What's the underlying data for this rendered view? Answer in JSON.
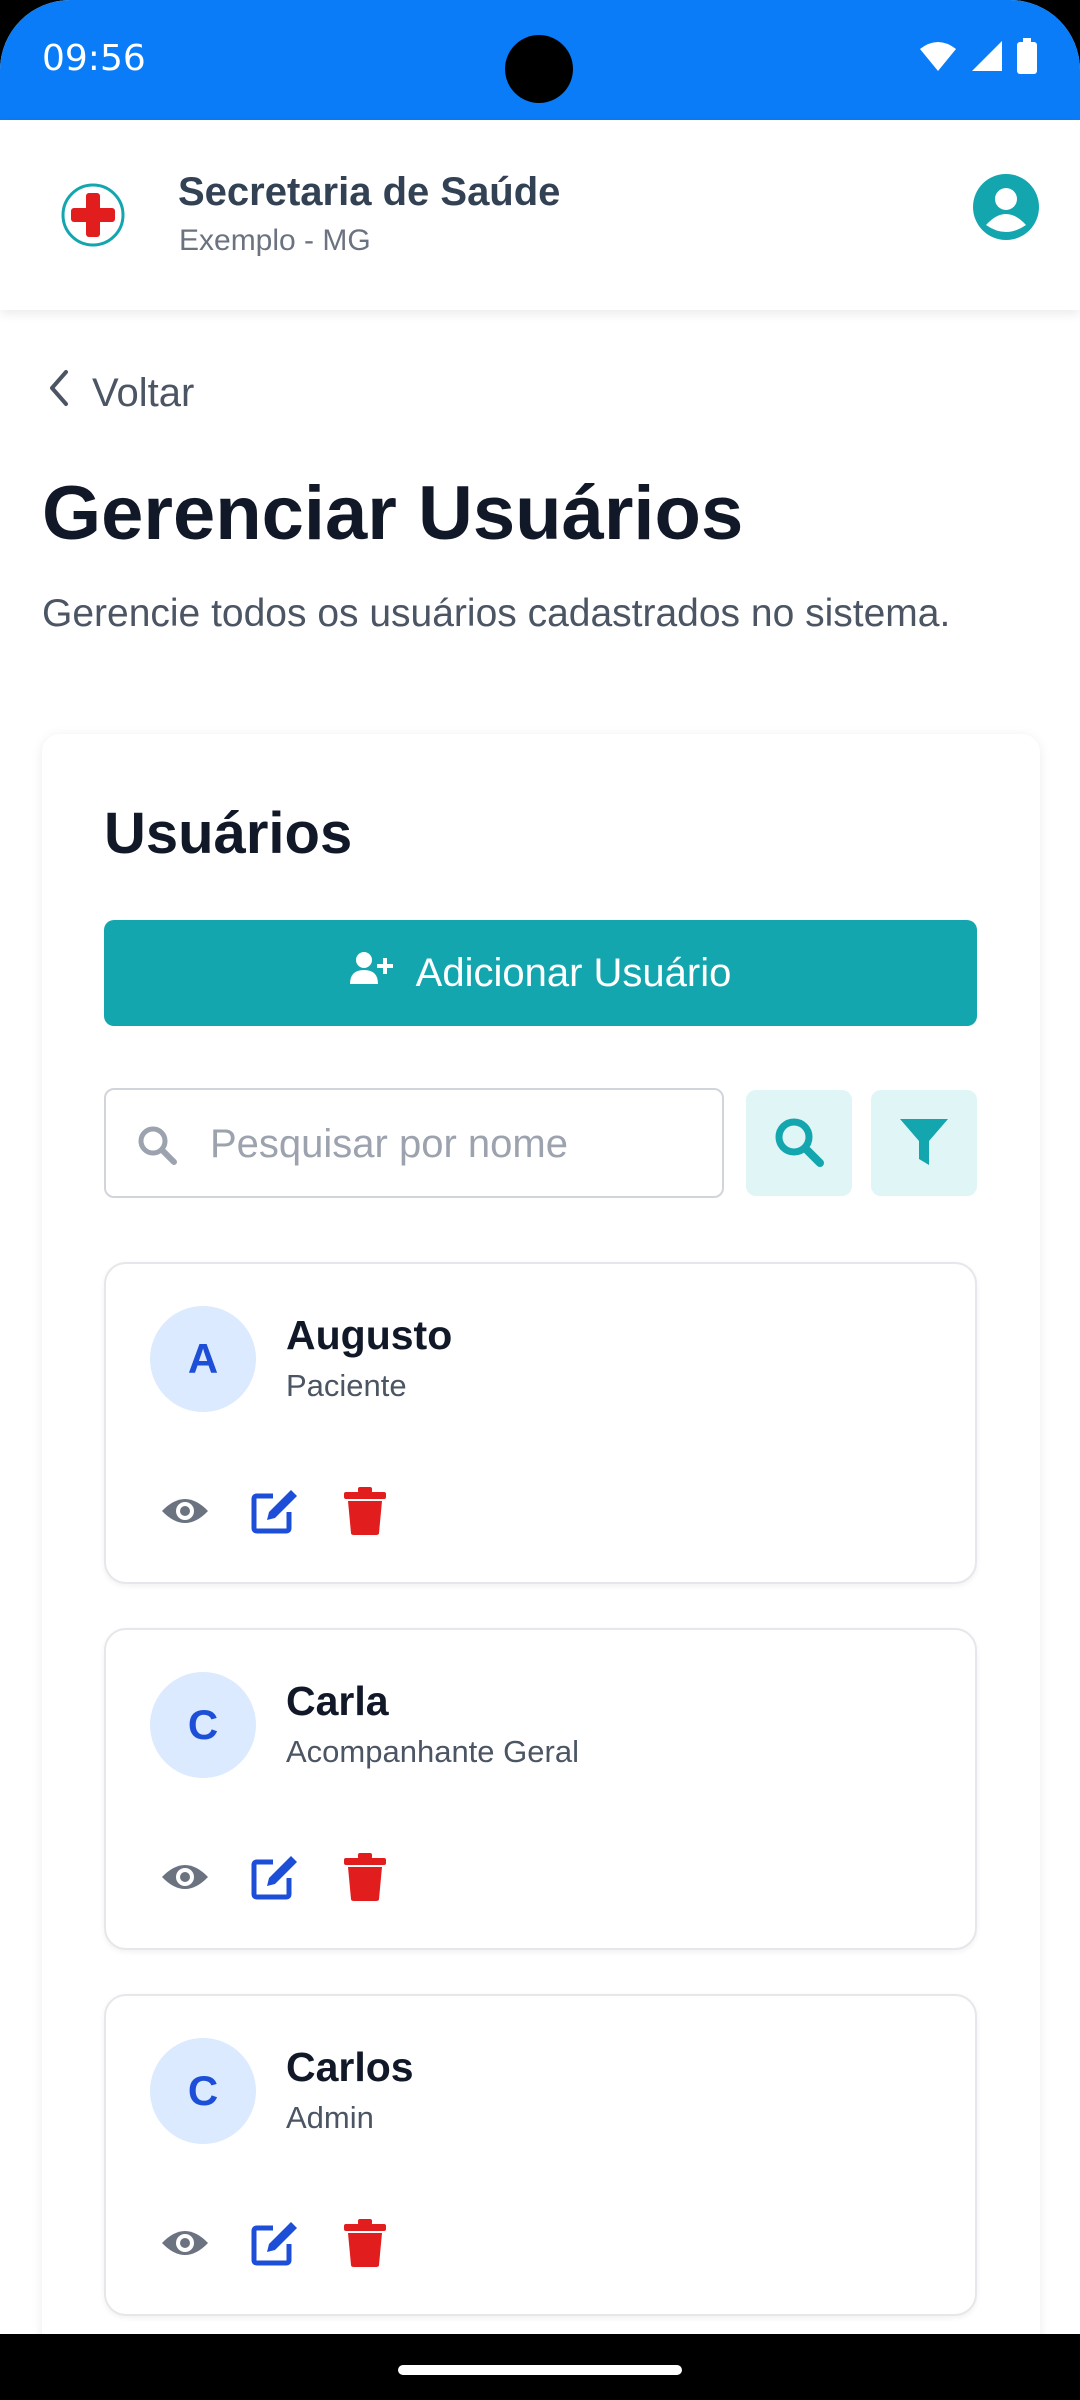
{
  "status_bar": {
    "time": "09:56"
  },
  "header": {
    "org_name": "Secretaria de Saúde",
    "org_location": "Exemplo - MG"
  },
  "page": {
    "back_label": "Voltar",
    "title": "Gerenciar Usuários",
    "subtitle": "Gerencie todos os usuários cadastrados no sistema."
  },
  "users_panel": {
    "title": "Usuários",
    "add_button_label": "Adicionar Usuário",
    "search": {
      "placeholder": "Pesquisar por nome",
      "value": ""
    },
    "users": [
      {
        "initial": "A",
        "name": "Augusto",
        "role": "Paciente"
      },
      {
        "initial": "C",
        "name": "Carla",
        "role": "Acompanhante Geral"
      },
      {
        "initial": "C",
        "name": "Carlos",
        "role": "Admin"
      }
    ]
  },
  "colors": {
    "status_bar": "#0a7cf7",
    "accent": "#13a6ae",
    "accent_light": "#e0f5f6",
    "edit": "#1d4ed8",
    "delete": "#e11d1d",
    "view": "#6b7280"
  }
}
